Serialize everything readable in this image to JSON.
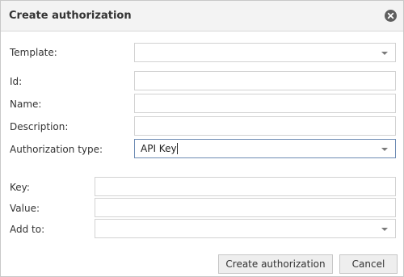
{
  "dialog": {
    "title": "Create authorization",
    "close_icon": "close-circle-icon"
  },
  "form": {
    "template": {
      "label": "Template:",
      "value": ""
    },
    "id": {
      "label": "Id:",
      "value": ""
    },
    "name": {
      "label": "Name:",
      "value": ""
    },
    "description": {
      "label": "Description:",
      "value": ""
    },
    "authorization_type": {
      "label": "Authorization type:",
      "value": "API Key"
    },
    "key": {
      "label": "Key:",
      "value": ""
    },
    "value": {
      "label": "Value:",
      "value": ""
    },
    "add_to": {
      "label": "Add to:",
      "value": ""
    }
  },
  "buttons": {
    "create_label": "Create authorization",
    "cancel_label": "Cancel"
  }
}
